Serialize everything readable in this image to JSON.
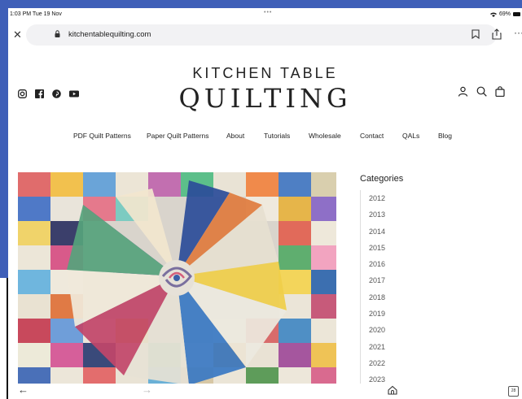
{
  "status": {
    "time": "1:03 PM  Tue 19 Nov",
    "dots": "•••",
    "battery": "69%"
  },
  "browser": {
    "url": "kitchentablequilting.com",
    "tab_count": "28"
  },
  "header": {
    "logo_top": "KITCHEN TABLE",
    "logo_main": "QUILTING",
    "nav": [
      "PDF Quilt Patterns",
      "Paper Quilt Patterns",
      "About",
      "Tutorials",
      "Wholesale",
      "Contact",
      "QALs",
      "Blog"
    ]
  },
  "sidebar": {
    "title": "Categories",
    "items": [
      "2012",
      "2013",
      "2014",
      "2015",
      "2016",
      "2017",
      "2018",
      "2019",
      "2020",
      "2021",
      "2022",
      "2023"
    ]
  },
  "icons": {
    "social": [
      "instagram-icon",
      "facebook-icon",
      "pinterest-icon",
      "youtube-icon"
    ],
    "header": [
      "account-icon",
      "search-icon",
      "bag-icon"
    ]
  },
  "colors": {
    "background_frame": "#3f5fb8",
    "text": "#222222",
    "muted": "#555555"
  }
}
